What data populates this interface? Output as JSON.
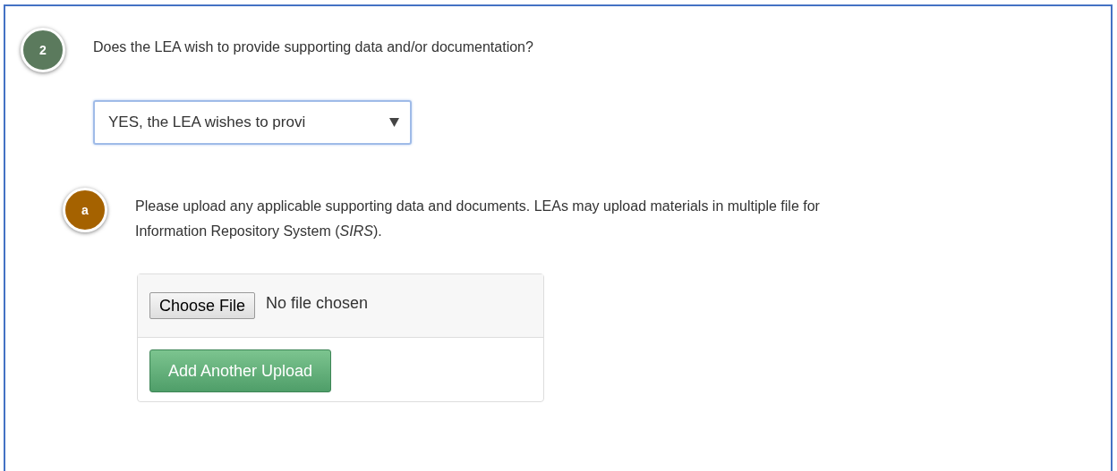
{
  "question": {
    "number": "2",
    "text": "Does the LEA wish to provide supporting data and/or documentation?",
    "select": {
      "value": "YES, the LEA wishes to provi"
    }
  },
  "subquestion": {
    "letter": "a",
    "lines": [
      "Please upload any applicable supporting data and documents.  LEAs may upload materials in multiple file for",
      "Information Repository System (*SIRS*)."
    ],
    "upload": {
      "choose_button": "Choose File",
      "file_status": "No file chosen",
      "add_button": "Add Another Upload"
    }
  }
}
